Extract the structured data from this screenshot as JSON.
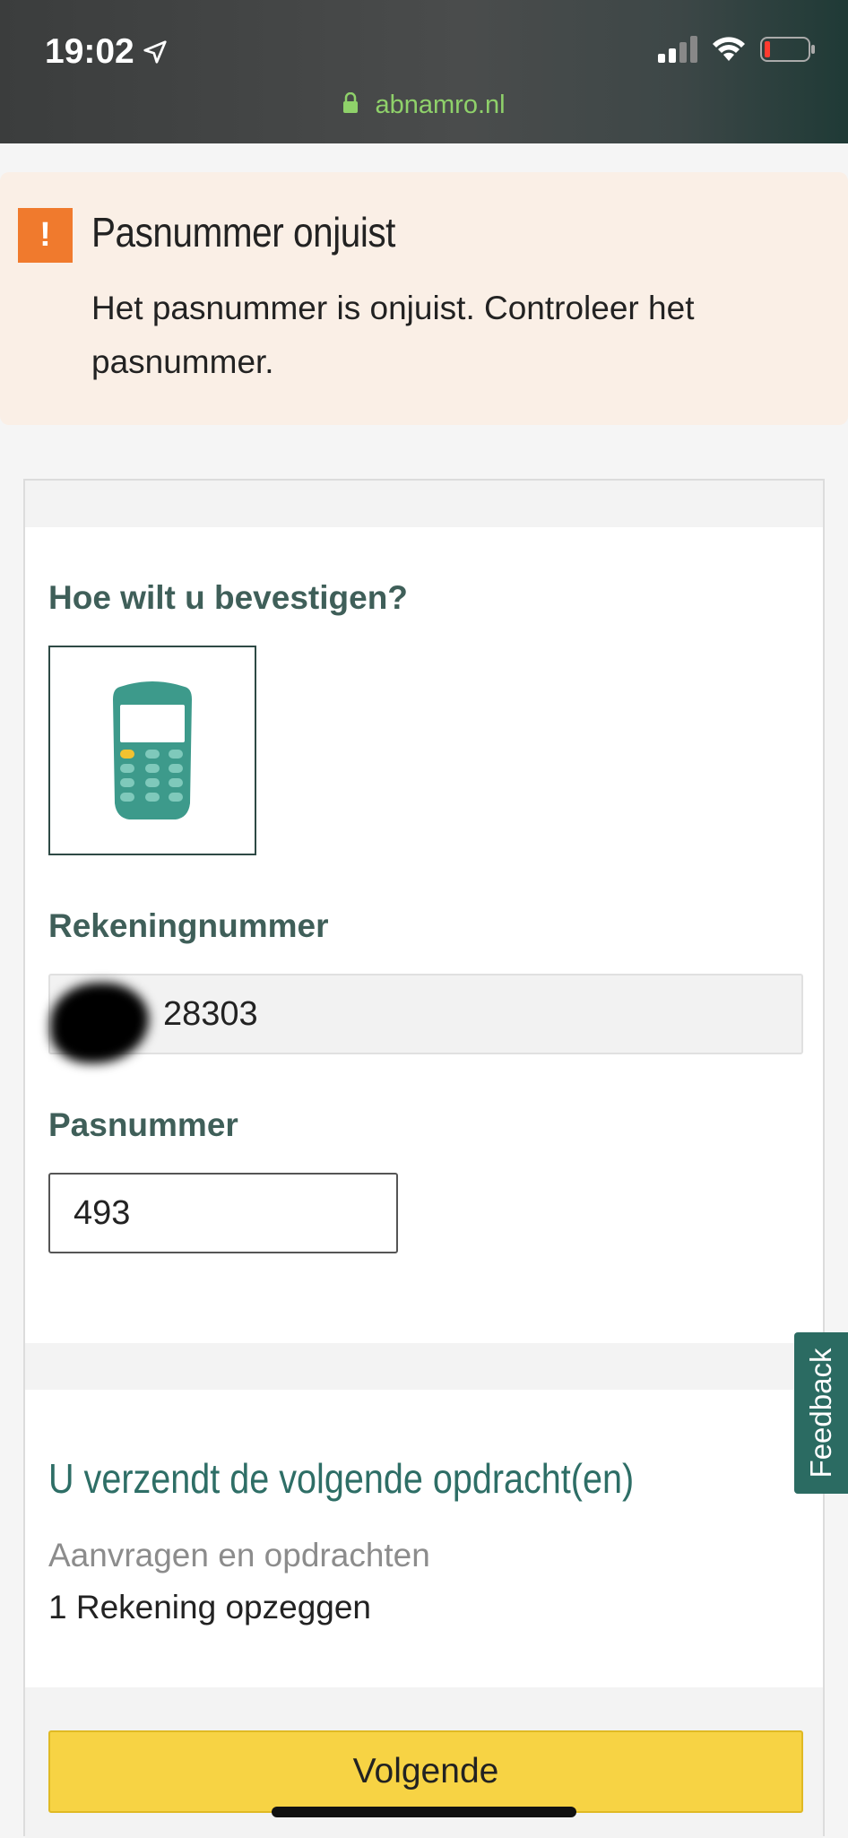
{
  "status_bar": {
    "time": "19:02",
    "url": "abnamro.nl",
    "icons": [
      "location-arrow-icon",
      "signal-icon",
      "wifi-icon",
      "battery-icon"
    ]
  },
  "alert": {
    "icon": "exclamation-icon",
    "title": "Pasnummer onjuist",
    "message": "Het pasnummer is onjuist. Controleer het pasnummer.",
    "color": "#f07a2d"
  },
  "form": {
    "confirm_label": "Hoe wilt u bevestigen?",
    "method_icon": "card-reader-icon",
    "account_label": "Rekeningnummer",
    "account_value_visible": "28303",
    "card_label": "Pasnummer",
    "card_value": "493"
  },
  "summary": {
    "title": "U verzendt de volgende opdracht(en)",
    "subtitle": "Aanvragen en opdrachten",
    "item": "1 Rekening opzeggen"
  },
  "actions": {
    "next_label": "Volgende",
    "feedback_label": "Feedback"
  },
  "colors": {
    "accent": "#2e6e66",
    "button": "#f7d344",
    "alert_bg": "#faefe6"
  }
}
